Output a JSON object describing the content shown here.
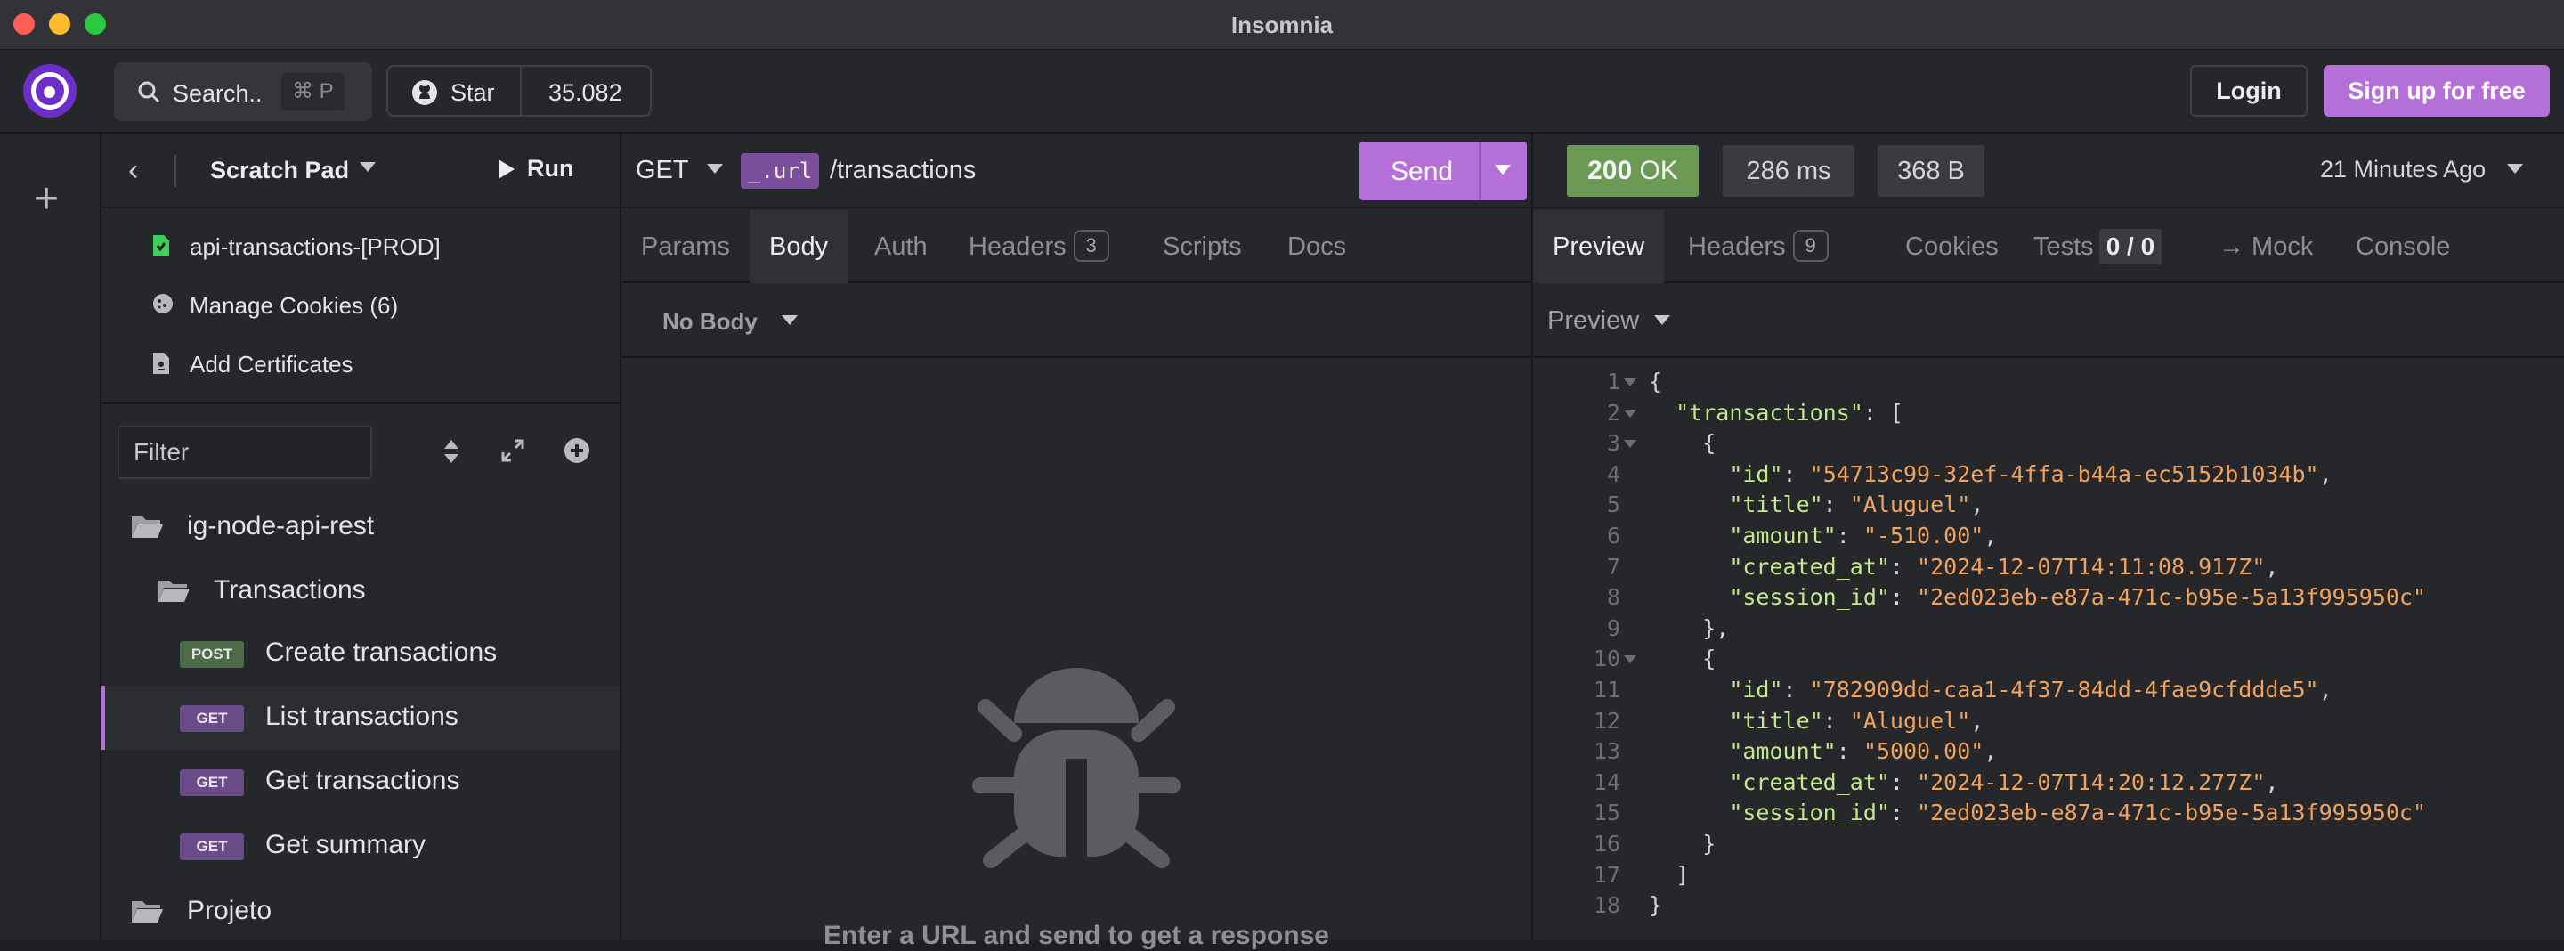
{
  "window": {
    "title": "Insomnia"
  },
  "header": {
    "search_label": "Search..",
    "search_shortcut": "⌘ P",
    "star_label": "Star",
    "star_count": "35.082",
    "login_label": "Login",
    "signup_label": "Sign up for free"
  },
  "sidebar": {
    "project_label": "Scratch Pad",
    "run_label": "Run",
    "links": [
      {
        "label": "api-transactions-[PROD]",
        "icon": "env-file-icon"
      },
      {
        "label": "Manage Cookies (6)",
        "icon": "cookie-icon"
      },
      {
        "label": "Add Certificates",
        "icon": "certificate-icon"
      }
    ],
    "filter_placeholder": "Filter",
    "tree": {
      "collection": "ig-node-api-rest",
      "folder": "Transactions",
      "requests": [
        {
          "method": "POST",
          "name": "Create transactions",
          "active": false
        },
        {
          "method": "GET",
          "name": "List transactions",
          "active": true
        },
        {
          "method": "GET",
          "name": "Get transactions",
          "active": false
        },
        {
          "method": "GET",
          "name": "Get summary",
          "active": false
        }
      ],
      "second_collection": "Projeto"
    }
  },
  "request": {
    "method": "GET",
    "url_var": "_.url",
    "url_path": "/transactions",
    "send_label": "Send",
    "tabs": [
      "Params",
      "Body",
      "Auth",
      "Headers",
      "Scripts",
      "Docs"
    ],
    "active_tab": "Body",
    "headers_count": "3",
    "body_mode": "No Body",
    "empty_message": "Enter a URL and send to get a response"
  },
  "response": {
    "status_code": "200",
    "status_text": "OK",
    "time": "286 ms",
    "size": "368 B",
    "time_ago": "21 Minutes Ago",
    "tabs": [
      "Preview",
      "Headers",
      "Cookies",
      "Tests",
      "→ Mock",
      "Console"
    ],
    "active_tab": "Preview",
    "headers_count": "9",
    "tests_value": "0 / 0",
    "preview_mode": "Preview",
    "json_lines": [
      "{",
      "  \"transactions\": [",
      "    {",
      "      \"id\": \"54713c99-32ef-4ffa-b44a-ec5152b1034b\",",
      "      \"title\": \"Aluguel\",",
      "      \"amount\": \"-510.00\",",
      "      \"created_at\": \"2024-12-07T14:11:08.917Z\",",
      "      \"session_id\": \"2ed023eb-e87a-471c-b95e-5a13f995950c\"",
      "    },",
      "    {",
      "      \"id\": \"782909dd-caa1-4f37-84dd-4fae9cfddde5\",",
      "      \"title\": \"Aluguel\",",
      "      \"amount\": \"5000.00\",",
      "      \"created_at\": \"2024-12-07T14:20:12.277Z\",",
      "      \"session_id\": \"2ed023eb-e87a-471c-b95e-5a13f995950c\"",
      "    }",
      "  ]",
      "}"
    ],
    "fold_lines": [
      1,
      2,
      3,
      10
    ]
  },
  "colors": {
    "accent": "#b56fd8",
    "status_ok": "#6a9a54",
    "post": "#4c6b46",
    "get": "#6c4b8a",
    "json_key": "#c3e88d",
    "json_string": "#f0a35e"
  }
}
